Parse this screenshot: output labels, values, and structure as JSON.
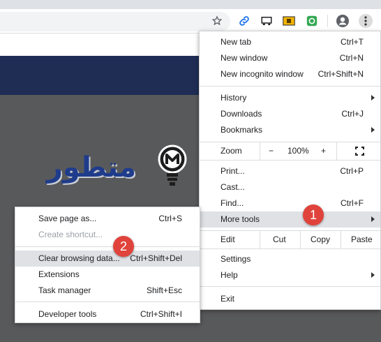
{
  "colors": {
    "accent": "#1a73e8",
    "banner": "#1f2d55",
    "page_bg": "#58595b",
    "highlight": "#dfe1e5",
    "badge": "#e0433b",
    "brand": "#1f3c8c"
  },
  "toolbar": {
    "icons": [
      "star-icon",
      "link-icon",
      "cast-icon",
      "folder-extension-icon",
      "green-extension-icon",
      "account-icon",
      "kebab-menu-icon"
    ]
  },
  "brand": {
    "text": "متطور"
  },
  "main_menu": {
    "new_tab": {
      "label": "New tab",
      "shortcut": "Ctrl+T"
    },
    "new_window": {
      "label": "New window",
      "shortcut": "Ctrl+N"
    },
    "new_incognito": {
      "label": "New incognito window",
      "shortcut": "Ctrl+Shift+N"
    },
    "history": {
      "label": "History"
    },
    "downloads": {
      "label": "Downloads",
      "shortcut": "Ctrl+J"
    },
    "bookmarks": {
      "label": "Bookmarks"
    },
    "zoom": {
      "label": "Zoom",
      "minus": "−",
      "value": "100%",
      "plus": "+"
    },
    "print": {
      "label": "Print...",
      "shortcut": "Ctrl+P"
    },
    "cast": {
      "label": "Cast..."
    },
    "find": {
      "label": "Find...",
      "shortcut": "Ctrl+F"
    },
    "more_tools": {
      "label": "More tools"
    },
    "edit": {
      "label": "Edit",
      "cut": "Cut",
      "copy": "Copy",
      "paste": "Paste"
    },
    "settings": {
      "label": "Settings"
    },
    "help": {
      "label": "Help"
    },
    "exit": {
      "label": "Exit"
    }
  },
  "more_tools_menu": {
    "save_page": {
      "label": "Save page as...",
      "shortcut": "Ctrl+S"
    },
    "create_shortcut": {
      "label": "Create shortcut..."
    },
    "clear_browsing": {
      "label": "Clear browsing data...",
      "shortcut": "Ctrl+Shift+Del"
    },
    "extensions": {
      "label": "Extensions"
    },
    "task_manager": {
      "label": "Task manager",
      "shortcut": "Shift+Esc"
    },
    "developer_tools": {
      "label": "Developer tools",
      "shortcut": "Ctrl+Shift+I"
    }
  },
  "badges": {
    "step1": "1",
    "step2": "2"
  }
}
